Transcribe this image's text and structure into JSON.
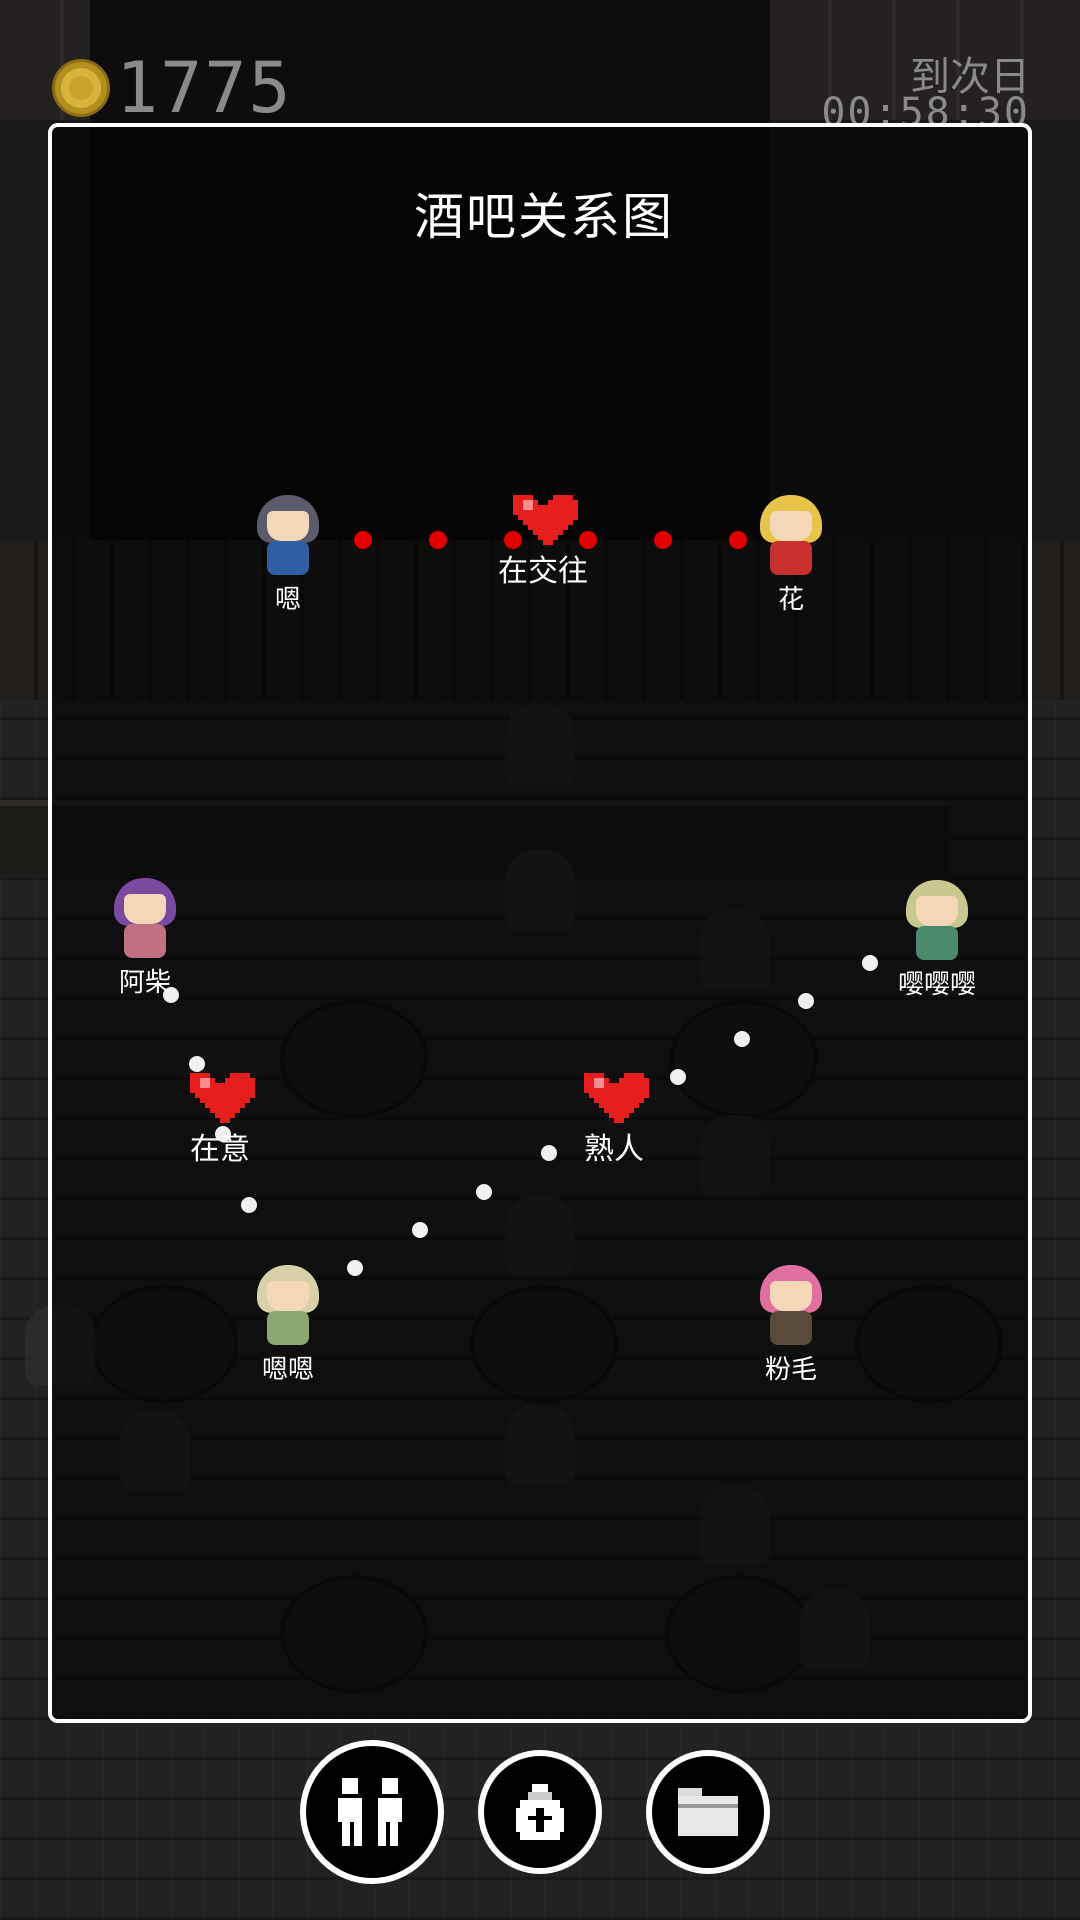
{
  "hud": {
    "coins": "1775",
    "timer_label": "到次日",
    "timer_value": "00:58:30"
  },
  "panel": {
    "title": "酒吧关系图"
  },
  "characters": [
    {
      "name": "嗯",
      "hair": "#5a5a6a",
      "body": "#2f5fa0"
    },
    {
      "name": "花",
      "hair": "#e8c44a",
      "body": "#c83030"
    },
    {
      "name": "阿柴",
      "hair": "#7a4aa0",
      "body": "#c07080"
    },
    {
      "name": "嘤嘤嘤",
      "hair": "#c8c890",
      "body": "#4a8a6a"
    },
    {
      "name": "嗯嗯",
      "hair": "#d8d0a8",
      "body": "#8aa870"
    },
    {
      "name": "粉毛",
      "hair": "#e070a0",
      "body": "#5a4a3a"
    }
  ],
  "relations": [
    {
      "label": "在交往",
      "dot_color": "#e00000"
    },
    {
      "label": "在意",
      "dot_color": "#f0f0f0"
    },
    {
      "label": "熟人",
      "dot_color": "#f0f0f0"
    }
  ],
  "colors": {
    "panel_border": "#ffffff",
    "heart": "#e61e1e",
    "relation_dot_red": "#e00000",
    "relation_dot_white": "#f0f0f0"
  },
  "buttons": [
    {
      "icon": "people-icon"
    },
    {
      "icon": "money-bag-icon"
    },
    {
      "icon": "folder-icon"
    }
  ]
}
